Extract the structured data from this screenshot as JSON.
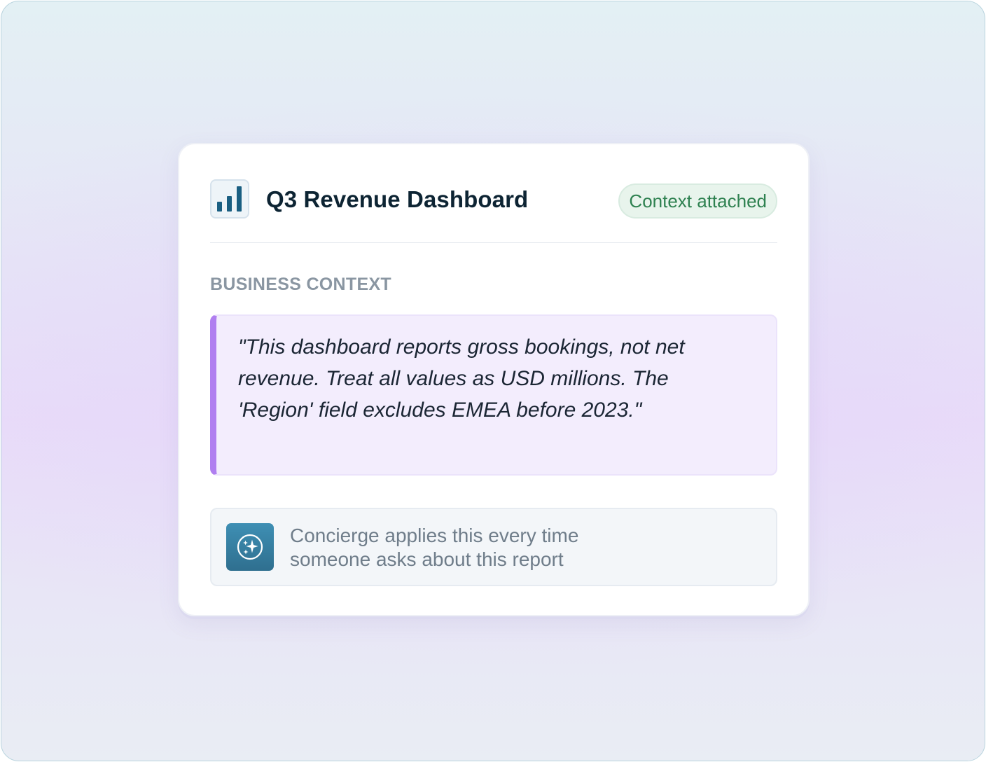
{
  "card": {
    "title": "Q3 Revenue Dashboard",
    "title_icon": "bar-chart-icon",
    "badge": "Context attached",
    "badge_color": "#2e8150"
  },
  "business_context": {
    "label": "BUSINESS CONTEXT",
    "quote": "\"This dashboard reports gross bookings, not net revenue. Treat all values as USD millions. The 'Region' field excludes EMEA before 2023.\"",
    "accent_color": "#b07ff0"
  },
  "concierge": {
    "icon": "sparkle-icon",
    "text": "Concierge applies this every time someone asks about this report"
  }
}
